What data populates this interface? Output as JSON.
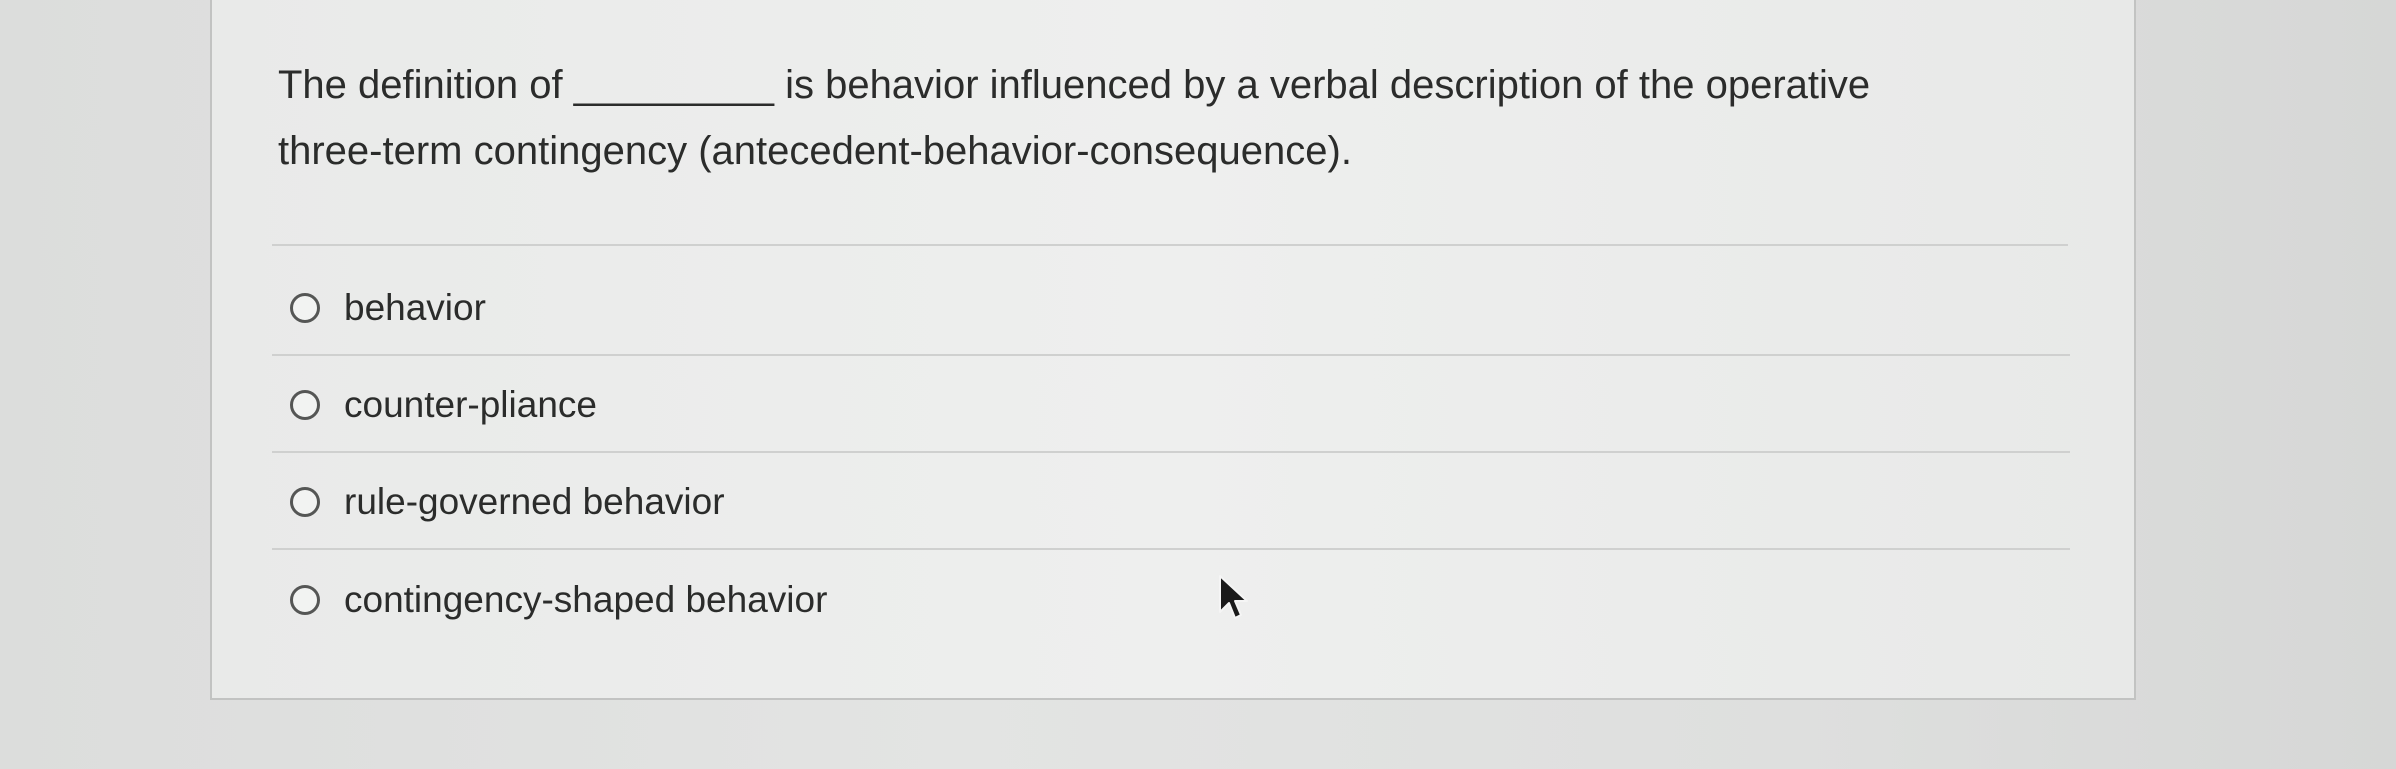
{
  "question": {
    "line1": "The definition of _________ is behavior influenced by a verbal description of the operative",
    "line2": "three-term contingency (antecedent-behavior-consequence)."
  },
  "options": [
    {
      "label": "behavior",
      "selected": false
    },
    {
      "label": "counter-pliance",
      "selected": false
    },
    {
      "label": "rule-governed behavior",
      "selected": false
    },
    {
      "label": "contingency-shaped behavior",
      "selected": false
    }
  ],
  "cursor": {
    "icon": "mouse-pointer-arrow-icon"
  }
}
